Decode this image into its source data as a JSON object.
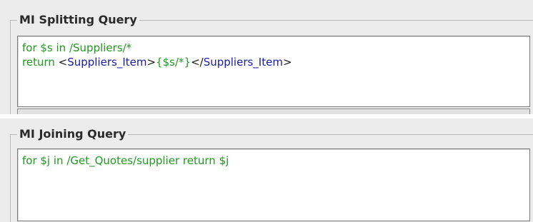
{
  "splitting": {
    "title": "MI Splitting Query",
    "lines": [
      [
        {
          "cls": "kw",
          "text": "for $s in /Suppliers/*"
        }
      ],
      [
        {
          "cls": "kw",
          "text": "return "
        },
        {
          "cls": "plain",
          "text": "<"
        },
        {
          "cls": "tag",
          "text": "Suppliers_Item"
        },
        {
          "cls": "plain",
          "text": ">"
        },
        {
          "cls": "kw",
          "text": "{$s/*}"
        },
        {
          "cls": "plain",
          "text": "</"
        },
        {
          "cls": "tag",
          "text": "Suppliers_Item"
        },
        {
          "cls": "plain",
          "text": ">"
        }
      ]
    ]
  },
  "joining": {
    "title": "MI Joining Query",
    "lines": [
      [
        {
          "cls": "kw",
          "text": "for $j in /Get_Quotes/supplier return $j"
        }
      ]
    ]
  },
  "colors": {
    "keyword": "#1f9a1f",
    "element_name": "#1a1aa8",
    "punctuation": "#1a1a1a"
  }
}
